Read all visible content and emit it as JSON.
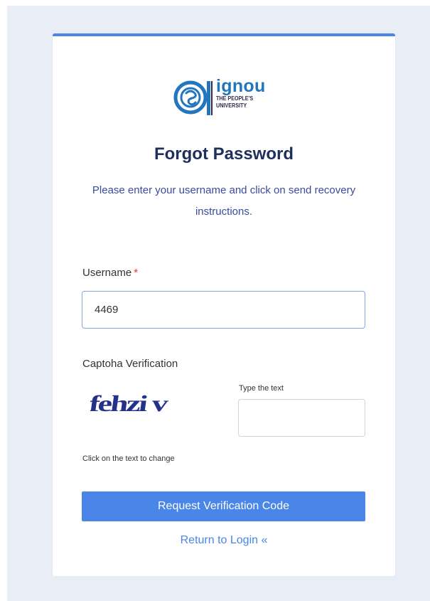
{
  "logo": {
    "name": "ignou",
    "tagline_line1": "THE PEOPLE'S",
    "tagline_line2": "UNIVERSITY",
    "icon": "ignou-emblem-icon",
    "color": "#2376bd"
  },
  "form": {
    "title": "Forgot Password",
    "subtitle": "Please enter your username and click on send recovery instructions.",
    "username_label": "Username",
    "required_marker": "*",
    "username_value": "4469",
    "captcha_label": "Captoha Verification",
    "captcha_text": "fehzi v",
    "captcha_hint": "Type the text",
    "captcha_input_value": "",
    "captcha_change_hint": "Click on the text to change",
    "submit_label": "Request Verification Code",
    "return_link": "Return to Login «"
  },
  "colors": {
    "accent": "#4a86e8",
    "title": "#1f2f5c",
    "subtitle": "#3a4a9f",
    "required": "#e53935",
    "background": "#e9edf5"
  }
}
